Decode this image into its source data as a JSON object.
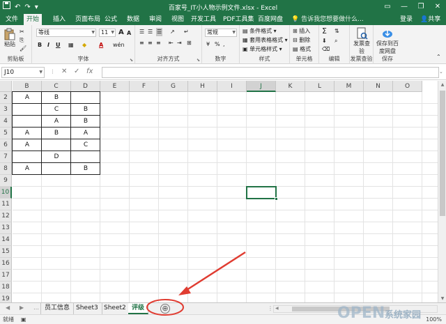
{
  "titlebar": {
    "title": "百家号_IT小人物示例文件.xlsx - Excel",
    "qat": [
      "save-icon",
      "undo-icon",
      "redo-icon",
      "customize-icon"
    ]
  },
  "tabs": [
    "文件",
    "开始",
    "插入",
    "页面布局",
    "公式",
    "数据",
    "审阅",
    "视图",
    "开发工具",
    "PDF工具集",
    "百度网盘"
  ],
  "active_tab": "开始",
  "tellme": "告诉我您想要做什么...",
  "login": "登录",
  "share": "共享",
  "ribbon": {
    "clipboard": {
      "paste": "粘贴",
      "label": "剪贴板"
    },
    "font": {
      "name": "等线",
      "size": "11",
      "bold": "B",
      "italic": "I",
      "underline": "U",
      "grow": "A",
      "shrink": "A",
      "label": "字体",
      "color": "A",
      "wen": "wén"
    },
    "alignment": {
      "label": "对齐方式"
    },
    "number": {
      "format": "常规",
      "label": "数字",
      "pct": "%",
      "comma": ","
    },
    "styles": {
      "conditional": "条件格式",
      "table": "套用表格格式",
      "cell": "单元格样式",
      "label": "样式"
    },
    "cells": {
      "insert": "插入",
      "delete": "删除",
      "format": "格式",
      "label": "单元格"
    },
    "editing": {
      "sum": "Σ",
      "label": "编辑"
    },
    "invoice": {
      "btn": "发票查验",
      "label": "发票查验"
    },
    "baidu": {
      "btn": "保存到百度网盘",
      "label": "保存"
    }
  },
  "formula": {
    "namebox": "J10",
    "cancel": "✕",
    "enter": "✓",
    "fx": "fx",
    "value": ""
  },
  "columns": [
    "B",
    "C",
    "D",
    "E",
    "F",
    "G",
    "H",
    "I",
    "J",
    "K",
    "L",
    "M",
    "N",
    "O"
  ],
  "selected_col": "J",
  "rows": [
    "2",
    "3",
    "4",
    "5",
    "6",
    "7",
    "8",
    "9",
    "10",
    "11",
    "12",
    "13",
    "14",
    "15",
    "16",
    "17",
    "18",
    "19"
  ],
  "selected_row": "10",
  "cells": [
    {
      "row": "2",
      "B": "A",
      "C": "B",
      "D": ""
    },
    {
      "row": "3",
      "B": "",
      "C": "C",
      "D": "B"
    },
    {
      "row": "4",
      "B": "",
      "C": "A",
      "D": "B"
    },
    {
      "row": "5",
      "B": "A",
      "C": "B",
      "D": "A"
    },
    {
      "row": "6",
      "B": "A",
      "C": "",
      "D": "C"
    },
    {
      "row": "7",
      "B": "",
      "C": "D",
      "D": ""
    },
    {
      "row": "8",
      "B": "A",
      "C": "",
      "D": "B"
    }
  ],
  "sheets": [
    "员工信息",
    "Sheet3",
    "Sheet2",
    "评级"
  ],
  "active_sheet": "评级",
  "add_sheet": "⊕",
  "status": {
    "ready": "就绪",
    "zoom": "100%"
  },
  "watermark": "OPEN 系统家园",
  "colors": {
    "accent": "#217346",
    "annotation": "#e03c31"
  }
}
